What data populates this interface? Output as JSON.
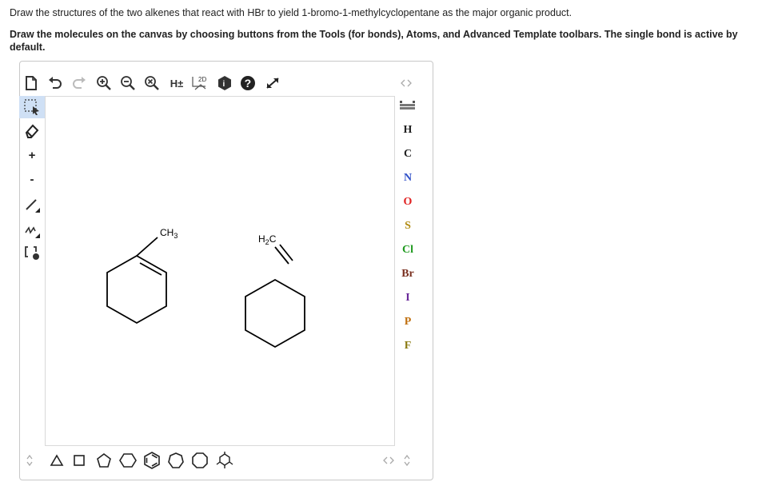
{
  "question": {
    "line1": "Draw the structures of the two alkenes that react with HBr to yield 1-bromo-1-methylcyclopentane as the major organic product.",
    "line2": "Draw the molecules on the canvas by choosing buttons from the Tools (for bonds), Atoms, and Advanced Template toolbars. The single bond is active by default."
  },
  "toolbar": {
    "hydrogen_toggle": "H±",
    "clean_2d": "2D",
    "help": "?",
    "info": "i"
  },
  "left_tools": {
    "plus": "+",
    "minus": "-"
  },
  "atoms": [
    "H",
    "C",
    "N",
    "O",
    "S",
    "Cl",
    "Br",
    "I",
    "P",
    "F"
  ],
  "atom_colors": {
    "H": "#222222",
    "C": "#222222",
    "N": "#3050c8",
    "O": "#e02020",
    "S": "#b08a10",
    "Cl": "#1f9a1f",
    "Br": "#7a3020",
    "I": "#6a2a9a",
    "P": "#c07010",
    "F": "#8a7a10"
  },
  "molecules": {
    "mol1_label": "CH",
    "mol1_sub": "3",
    "mol2_label_h": "H",
    "mol2_sub": "2",
    "mol2_label_c": "C"
  },
  "colors": {
    "selected_tool_bg": "#cfe0f5",
    "border": "#c8c8c8"
  }
}
